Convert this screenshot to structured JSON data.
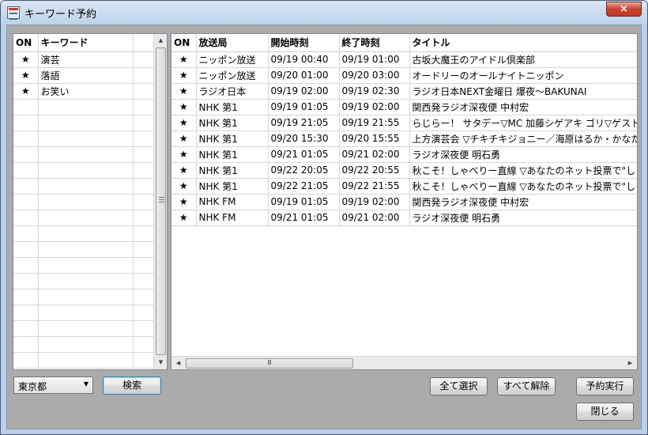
{
  "window": {
    "title": "キーワード予約",
    "close_label": "×"
  },
  "keywords": {
    "columns": [
      "ON",
      "キーワード"
    ],
    "rows": [
      {
        "on": "★",
        "keyword": "演芸"
      },
      {
        "on": "★",
        "keyword": "落語"
      },
      {
        "on": "★",
        "keyword": "お笑い"
      }
    ]
  },
  "results": {
    "columns": [
      "ON",
      "放送局",
      "開始時刻",
      "終了時刻",
      "タイトル"
    ],
    "rows": [
      {
        "on": "★",
        "station": "ニッポン放送",
        "start": "09/19 00:40",
        "end": "09/19 01:00",
        "title": "古坂大魔王のアイドル倶楽部"
      },
      {
        "on": "★",
        "station": "ニッポン放送",
        "start": "09/20 01:00",
        "end": "09/20 03:00",
        "title": "オードリーのオールナイトニッポン"
      },
      {
        "on": "★",
        "station": "ラジオ日本",
        "start": "09/19 02:00",
        "end": "09/19 02:30",
        "title": "ラジオ日本NEXT金曜日 爆夜～BAKUNAI"
      },
      {
        "on": "★",
        "station": "NHK 第1",
        "start": "09/19 01:05",
        "end": "09/19 02:00",
        "title": "関西発ラジオ深夜便 中村宏"
      },
      {
        "on": "★",
        "station": "NHK 第1",
        "start": "09/19 21:05",
        "end": "09/19 21:55",
        "title": "らじらー！ サタデー▽MC 加藤シゲアキ ゴリ▽ゲスト 清水"
      },
      {
        "on": "★",
        "station": "NHK 第1",
        "start": "09/20 15:30",
        "end": "09/20 15:55",
        "title": "上方演芸会 ▽チキチキジョニー／海原はるか・かなた"
      },
      {
        "on": "★",
        "station": "NHK 第1",
        "start": "09/21 01:05",
        "end": "09/21 02:00",
        "title": "ラジオ深夜便 明石勇"
      },
      {
        "on": "★",
        "station": "NHK 第1",
        "start": "09/22 20:05",
        "end": "09/22 20:55",
        "title": "秋こそ！しゃべりー直線 ▽あなたのネット投票で\"しゃべり三"
      },
      {
        "on": "★",
        "station": "NHK 第1",
        "start": "09/22 21:05",
        "end": "09/22 21:55",
        "title": "秋こそ！しゃべりー直線 ▽あなたのネット投票で\"しゃべり三"
      },
      {
        "on": "★",
        "station": "NHK FM",
        "start": "09/19 01:05",
        "end": "09/19 02:00",
        "title": "関西発ラジオ深夜便 中村宏"
      },
      {
        "on": "★",
        "station": "NHK FM",
        "start": "09/21 01:05",
        "end": "09/21 02:00",
        "title": "ラジオ深夜便 明石勇"
      }
    ]
  },
  "controls": {
    "area_select": "東京都",
    "search_button": "検索",
    "select_all_button": "全て選択",
    "deselect_all_button": "すべて解除",
    "execute_button": "予約実行",
    "close_button": "閉じる"
  },
  "scrollbar": {
    "grip": "Ⅲ"
  }
}
